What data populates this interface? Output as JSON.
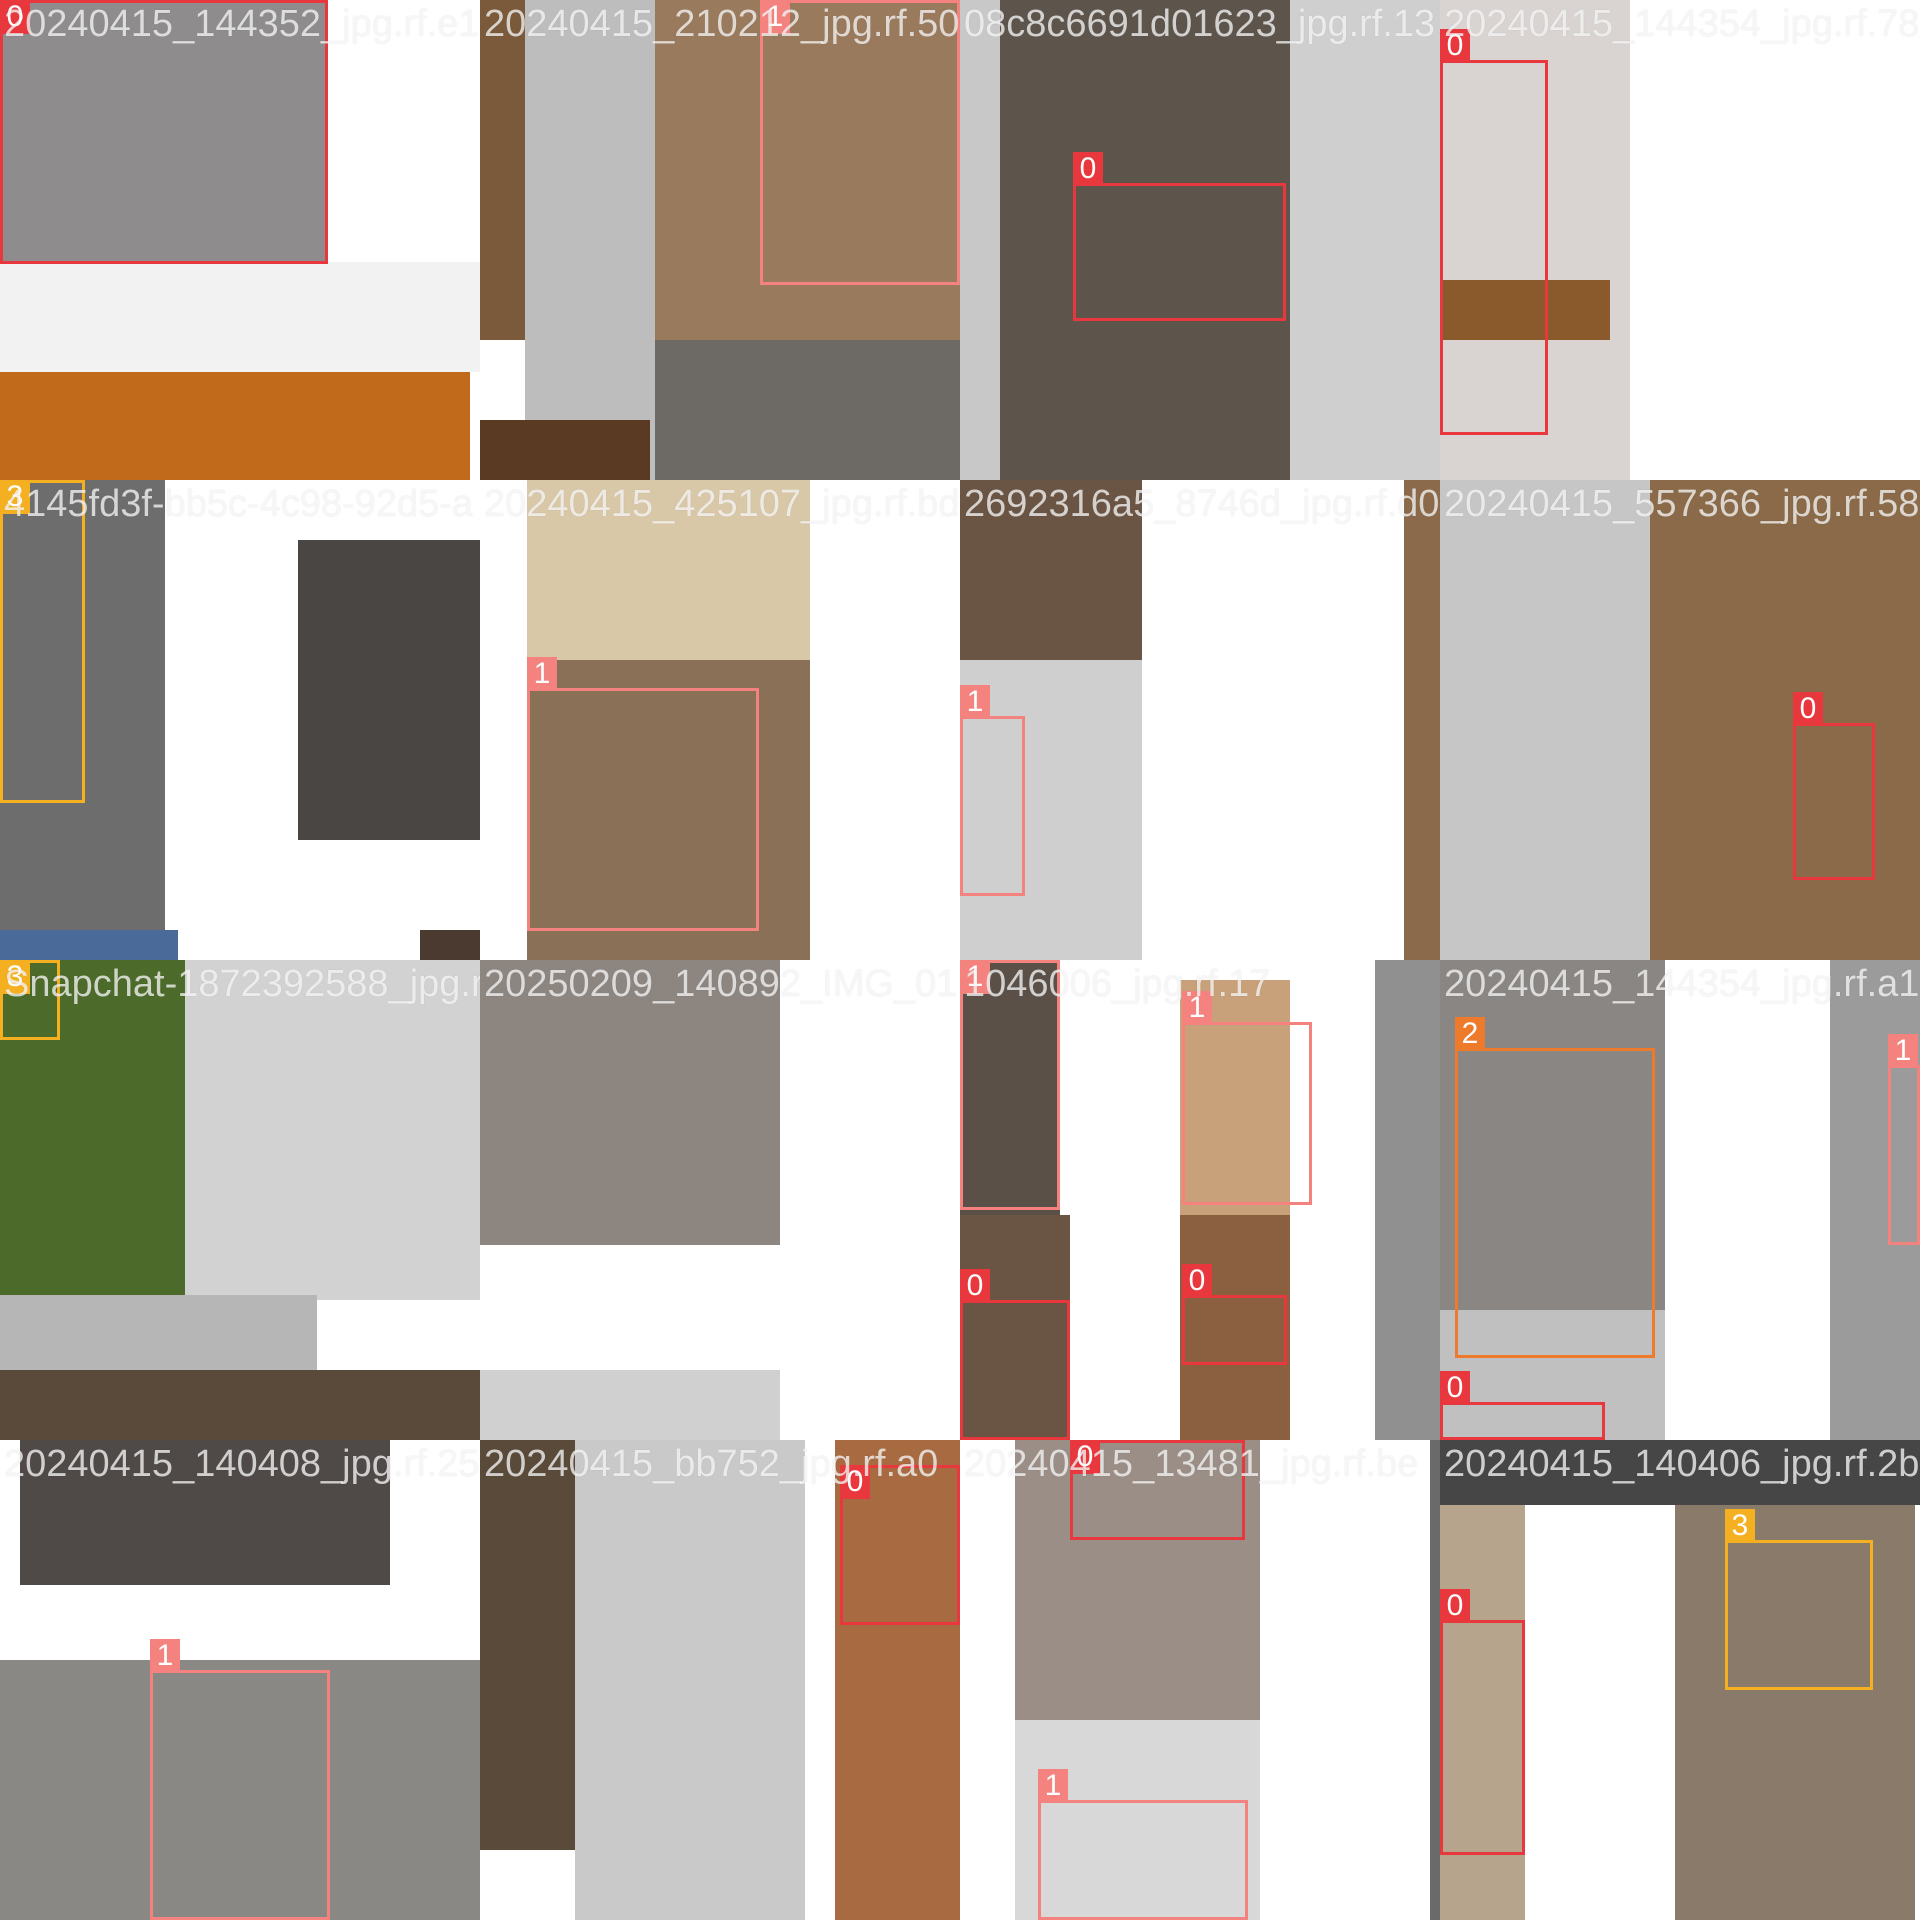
{
  "class_colors": {
    "0": "#e8383d",
    "1": "#f4837f",
    "2": "#ee7a2b",
    "3": "#f5b021"
  },
  "tiles": [
    {
      "filename": "20240415_144352_jpg.rf.e1",
      "boxes": [
        {
          "cls": "0"
        }
      ]
    },
    {
      "filename": "20240415_210212_jpg.rf.50",
      "boxes": [
        {
          "cls": "1"
        }
      ]
    },
    {
      "filename": "08c8c6691d01623_jpg.rf.13",
      "boxes": [
        {
          "cls": "0"
        }
      ]
    },
    {
      "filename": "20240415_144354_jpg.rf.78",
      "boxes": [
        {
          "cls": "0"
        }
      ]
    },
    {
      "filename": "4145fd3f-bb5c-4c98-92d5-a",
      "boxes": [
        {
          "cls": "3"
        }
      ]
    },
    {
      "filename": "20240415_425107_jpg.rf.bd",
      "boxes": [
        {
          "cls": "1"
        }
      ]
    },
    {
      "filename": "2692316a5_8746d_jpg.rf.d0",
      "boxes": [
        {
          "cls": "1"
        }
      ]
    },
    {
      "filename": "20240415_557366_jpg.rf.58",
      "boxes": [
        {
          "cls": "0"
        }
      ]
    },
    {
      "filename": "Snapchat-1872392588_jpg.r",
      "boxes": [
        {
          "cls": "3"
        }
      ]
    },
    {
      "filename": "20250209_140892_IMG_01",
      "boxes": []
    },
    {
      "filename": "1046006_jpg.rf.17",
      "boxes": [
        {
          "cls": "1"
        },
        {
          "cls": "1"
        },
        {
          "cls": "0"
        },
        {
          "cls": "0"
        }
      ]
    },
    {
      "filename": "20240415_144354_jpg.rf.a1",
      "boxes": [
        {
          "cls": "2"
        },
        {
          "cls": "1"
        },
        {
          "cls": "0"
        }
      ]
    },
    {
      "filename": "20240415_140408_jpg.rf.25",
      "boxes": [
        {
          "cls": "1"
        }
      ]
    },
    {
      "filename": "20240415_bb752_jpg.rf.a0",
      "boxes": [
        {
          "cls": "0"
        }
      ]
    },
    {
      "filename": "20240415_13481_jpg.rf.be",
      "boxes": [
        {
          "cls": "0"
        },
        {
          "cls": "1"
        }
      ]
    },
    {
      "filename": "20240415_140406_jpg.rf.2b",
      "boxes": [
        {
          "cls": "3"
        },
        {
          "cls": "0"
        }
      ]
    }
  ]
}
